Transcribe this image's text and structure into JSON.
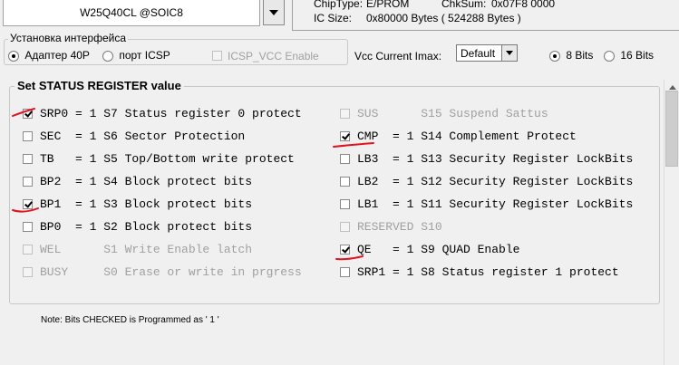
{
  "chip": {
    "name": "W25Q40CL @SOIC8",
    "type_label": "ChipType:",
    "type_value": "E/PROM",
    "checksum_label": "ChkSum:",
    "checksum_value": "0x07F8 0000",
    "size_label": "IC Size:",
    "size_value": "0x80000 Bytes ( 524288 Bytes )"
  },
  "interface": {
    "title": "Установка интерфейса",
    "adapter_label": "Адаптер 40P",
    "adapter_selected": true,
    "icsp_label": "порт ICSP",
    "icsp_selected": false,
    "icsp_vcc_label": "ICSP_VCC Enable",
    "icsp_vcc_checked": false,
    "icsp_vcc_enabled": false
  },
  "vcc": {
    "label": "Vcc Current Imax:",
    "value": "Default"
  },
  "bits_mode": {
    "bits8_label": "8 Bits",
    "bits8_selected": true,
    "bits16_label": "16 Bits",
    "bits16_selected": false
  },
  "status_register": {
    "title": "Set STATUS REGISTER value",
    "left_bits": [
      {
        "text": "SRP0 = 1 S7 Status register 0 protect",
        "checked": true,
        "enabled": true
      },
      {
        "text": "SEC  = 1 S6 Sector Protection",
        "checked": false,
        "enabled": true
      },
      {
        "text": "TB   = 1 S5 Top/Bottom write protect",
        "checked": false,
        "enabled": true
      },
      {
        "text": "BP2  = 1 S4 Block protect bits",
        "checked": false,
        "enabled": true
      },
      {
        "text": "BP1  = 1 S3 Block protect bits",
        "checked": true,
        "enabled": true
      },
      {
        "text": "BP0  = 1 S2 Block protect bits",
        "checked": false,
        "enabled": true
      },
      {
        "text": "WEL      S1 Write Enable latch",
        "checked": false,
        "enabled": false
      },
      {
        "text": "BUSY     S0 Erase or write in prgress",
        "checked": false,
        "enabled": false
      }
    ],
    "right_bits": [
      {
        "text": "SUS      S15 Suspend Sattus",
        "checked": false,
        "enabled": false
      },
      {
        "text": "CMP  = 1 S14 Complement Protect",
        "checked": true,
        "enabled": true
      },
      {
        "text": "LB3  = 1 S13 Security Register LockBits",
        "checked": false,
        "enabled": true
      },
      {
        "text": "LB2  = 1 S12 Security Register LockBits",
        "checked": false,
        "enabled": true
      },
      {
        "text": "LB1  = 1 S11 Security Register LockBits",
        "checked": false,
        "enabled": true
      },
      {
        "text": "RESERVED S10",
        "checked": false,
        "enabled": false
      },
      {
        "text": "QE   = 1 S9 QUAD Enable",
        "checked": true,
        "enabled": true
      },
      {
        "text": "SRP1 = 1 S8 Status register 1 protect",
        "checked": false,
        "enabled": true
      }
    ]
  },
  "note": "Note: Bits CHECKED is Programmed as ' 1 '",
  "colors": {
    "window_bg": "#f0f0f0",
    "annotation_ink": "#e0141e",
    "disabled_text": "#a0a0a0"
  },
  "icons": {
    "chip_dropdown": "chevron-down-icon",
    "vcc_dropdown": "chevron-down-icon",
    "scroll_up": "arrow-up-icon"
  }
}
